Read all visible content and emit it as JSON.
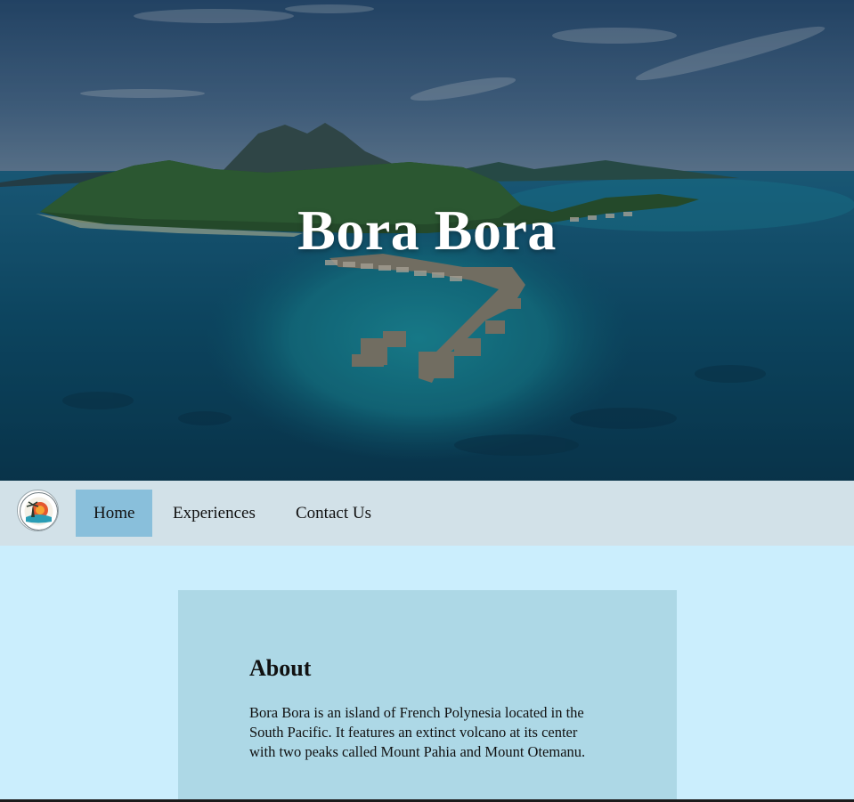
{
  "hero": {
    "title": "Bora Bora"
  },
  "nav": {
    "logo_icon": "resort-logo-icon",
    "items": [
      {
        "label": "Home",
        "active": true
      },
      {
        "label": "Experiences",
        "active": false
      },
      {
        "label": "Contact Us",
        "active": false
      }
    ]
  },
  "about": {
    "heading": "About",
    "text": "Bora Bora is an island of French Polynesia located in the South Pacific. It features an extinct volcano at its center with two peaks called Mount Pahia and Mount Otemanu."
  },
  "colors": {
    "page_bg": "#cbeefd",
    "nav_bg": "#d2e1e8",
    "nav_active": "#89bfdb",
    "card_bg": "#add8e6"
  }
}
